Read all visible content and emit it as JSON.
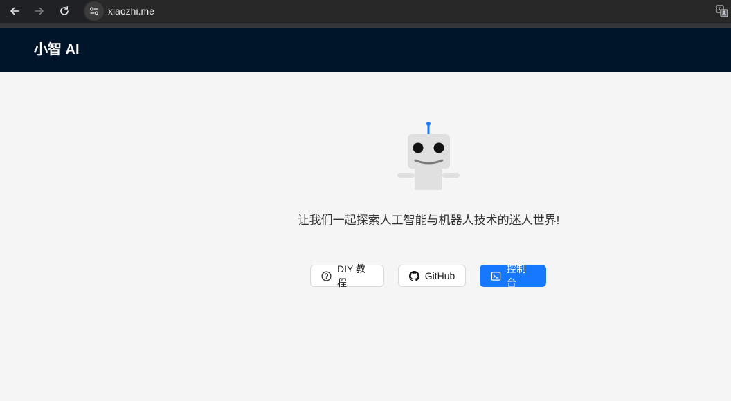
{
  "browser": {
    "url": "xiaozhi.me"
  },
  "header": {
    "brand": "小智 AI"
  },
  "main": {
    "tagline": "让我们一起探索人工智能与机器人技术的迷人世界!",
    "buttons": {
      "diy": "DIY 教程",
      "github": "GitHub",
      "console": "控制台"
    }
  },
  "colors": {
    "header_bg": "#001529",
    "primary": "#1677ff",
    "page_bg": "#f5f5f5"
  }
}
